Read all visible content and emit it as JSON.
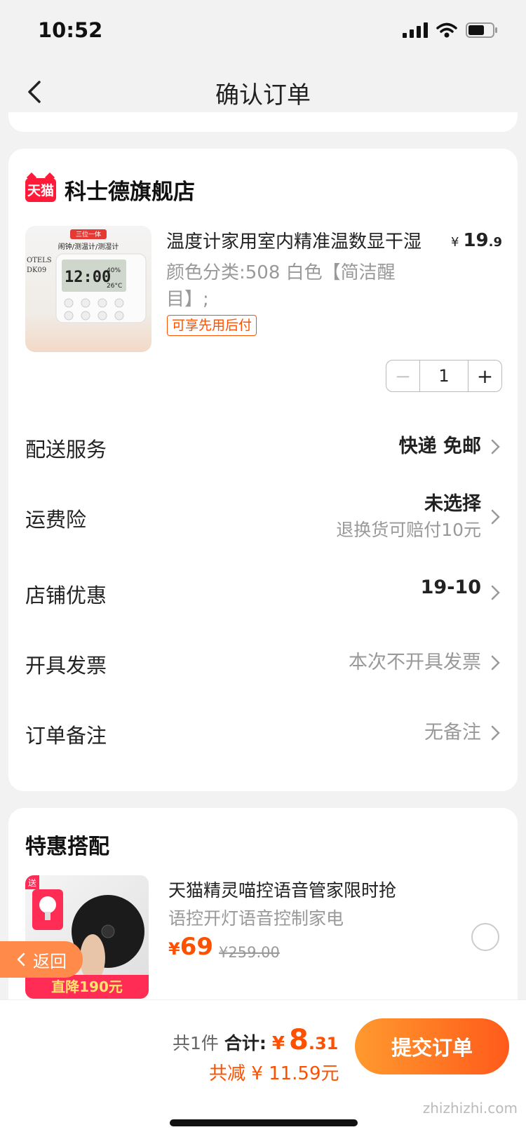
{
  "status_bar": {
    "time": "10:52",
    "icons": [
      "signal-icon",
      "wifi-icon",
      "battery-icon"
    ]
  },
  "nav": {
    "back_icon": "chevron-left-icon",
    "title": "确认订单"
  },
  "shop": {
    "badge": "天猫",
    "name": "科士德旗舰店",
    "product": {
      "title": "温度计家用室内精准温数显干湿",
      "price_symbol": "¥",
      "price_int": "19",
      "price_dec": ".9",
      "spec": "颜色分类:508 白色【简洁醒目】;",
      "tag": "可享先用后付",
      "quantity": "1",
      "minus_label": "−",
      "plus_label": "+",
      "image_text": {
        "badge": "三位一体",
        "caption": "闹钟/测温计/测湿计",
        "brand": "OTELS",
        "model": "DK09",
        "time": "12:00",
        "humidity": "40%",
        "temp": "26°C"
      }
    },
    "rows": [
      {
        "label": "配送服务",
        "value": "快递 免邮",
        "style": "bold"
      },
      {
        "label": "运费险",
        "value": "未选择",
        "sub": "退换货可赔付10元",
        "style": "bold"
      },
      {
        "label": "店铺优惠",
        "value": "19-10",
        "style": "bold"
      },
      {
        "label": "开具发票",
        "value": "本次不开具发票",
        "style": "grey"
      },
      {
        "label": "订单备注",
        "value": "无备注",
        "style": "grey"
      }
    ]
  },
  "deal": {
    "title": "特惠搭配",
    "item": {
      "name": "天猫精灵喵控语音管家限时抢",
      "desc": "语控开灯语音控制家电",
      "price_symbol": "¥",
      "price": "69",
      "original": "¥259.00",
      "image_badge": "送",
      "image_banner": "直降190元"
    }
  },
  "float_back": {
    "icon": "chevron-left-icon",
    "label": "返回"
  },
  "bottom": {
    "count": "共1件",
    "total_label": "合计:",
    "total_symbol": "¥",
    "total_int": "8",
    "total_dec": ".31",
    "saved": "共减 ¥ 11.59元",
    "submit": "提交订单"
  },
  "watermark": "zhizhizhi.com",
  "colors": {
    "accent": "#ff5000",
    "tmall": "#ff1a3a",
    "button_start": "#ff9a2e",
    "button_end": "#ff5a1a"
  }
}
